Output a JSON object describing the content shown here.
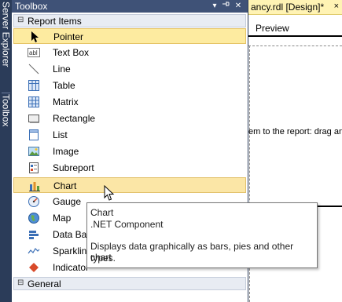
{
  "side_tabs": {
    "server_explorer": "Server Explorer",
    "toolbox": "Toolbox"
  },
  "toolbox": {
    "title": "Toolbox",
    "buttons": [
      "dropdown-icon",
      "pin-icon",
      "close-icon"
    ],
    "categories": [
      {
        "label": "Report Items",
        "expanded": true
      },
      {
        "label": "General",
        "expanded": true
      }
    ],
    "items": [
      {
        "label": "Pointer",
        "icon": "pointer-icon",
        "state": "selected"
      },
      {
        "label": "Text Box",
        "icon": "textbox-icon"
      },
      {
        "label": "Line",
        "icon": "line-icon"
      },
      {
        "label": "Table",
        "icon": "table-icon"
      },
      {
        "label": "Matrix",
        "icon": "matrix-icon"
      },
      {
        "label": "Rectangle",
        "icon": "rectangle-icon"
      },
      {
        "label": "List",
        "icon": "list-icon"
      },
      {
        "label": "Image",
        "icon": "image-icon"
      },
      {
        "label": "Subreport",
        "icon": "subreport-icon"
      },
      {
        "label": "Chart",
        "icon": "chart-icon",
        "state": "hover"
      },
      {
        "label": "Gauge",
        "icon": "gauge-icon"
      },
      {
        "label": "Map",
        "icon": "map-icon"
      },
      {
        "label": "Data Bar",
        "icon": "databar-icon"
      },
      {
        "label": "Sparkline",
        "icon": "sparkline-icon"
      },
      {
        "label": "Indicator",
        "icon": "indicator-icon"
      }
    ]
  },
  "document": {
    "tab_title": "ancy.rdl [Design]*",
    "close_glyph": "×",
    "preview_tab": "Preview",
    "hint_text": "em to the report: drag an"
  },
  "tooltip": {
    "title": "Chart",
    "subtitle": ".NET Component",
    "description_line1": "Displays data graphically as bars, pies and other chart",
    "description_line2": "types."
  },
  "colors": {
    "title_bar": "#3f5277",
    "frame": "#2b3c59",
    "selected": "#fdeba0",
    "doc_tab": "#fff3b4"
  }
}
